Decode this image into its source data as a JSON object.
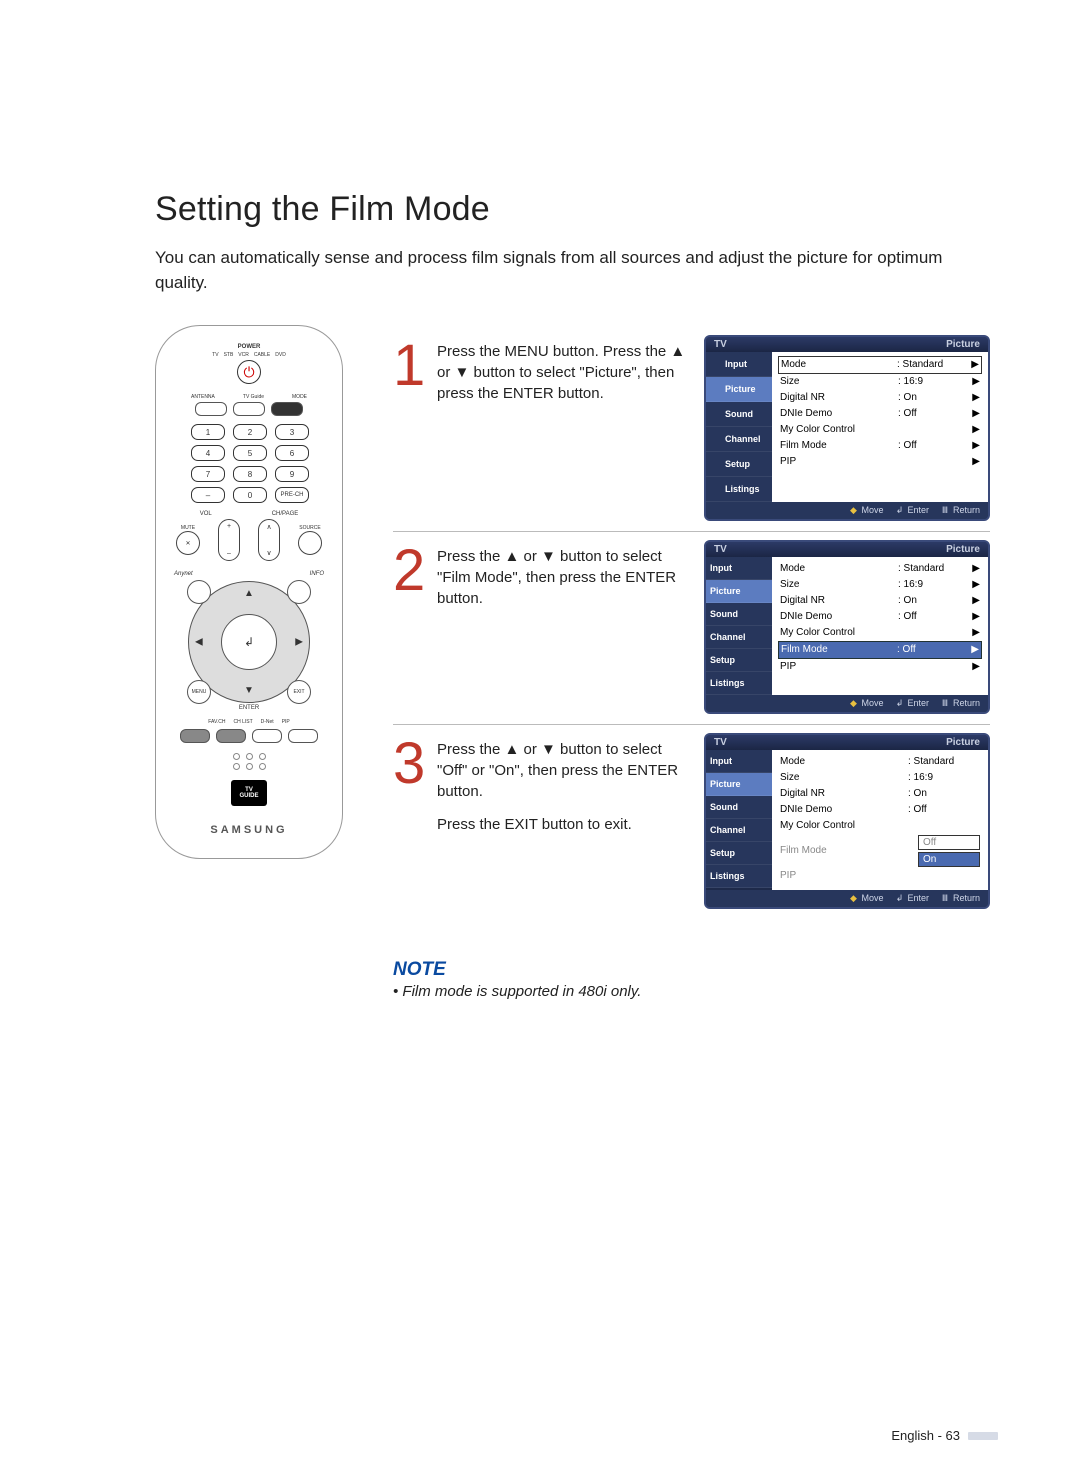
{
  "title": "Setting the Film Mode",
  "intro": "You can automatically sense and process film signals from all sources and adjust the picture for optimum quality.",
  "remote": {
    "power": "POWER",
    "devices": [
      "TV",
      "STB",
      "VCR",
      "CABLE",
      "DVD"
    ],
    "row_labels": [
      "ANTENNA",
      "TV Guide",
      "MODE"
    ],
    "prech": "PRE-CH",
    "vol": "VOL",
    "chpage": "CH/PAGE",
    "mute": "MUTE",
    "source": "SOURCE",
    "anynet": "Anynet",
    "info": "INFO",
    "menu": "MENU",
    "exit": "EXIT",
    "enter": "ENTER",
    "bottom_labels": [
      "FAV.CH",
      "CH LIST",
      "D-Net",
      "PIP"
    ],
    "tvguide_a": "TV",
    "tvguide_b": "GUIDE",
    "brand": "SAMSUNG"
  },
  "steps": [
    {
      "num": "1",
      "text": "Press the MENU button. Press the ▲ or ▼ button to select \"Picture\", then press the ENTER button."
    },
    {
      "num": "2",
      "text": "Press the ▲ or ▼ button to select \"Film Mode\", then press the ENTER button."
    },
    {
      "num": "3",
      "text_a": "Press the ▲ or ▼ button to select \"Off\" or \"On\", then press the ENTER button.",
      "text_b": "Press the EXIT button to exit."
    }
  ],
  "osd": {
    "tv": "TV",
    "section": "Picture",
    "tabs": [
      "Input",
      "Picture",
      "Sound",
      "Channel",
      "Setup",
      "Listings"
    ],
    "items": [
      {
        "k": "Mode",
        "v": ": Standard"
      },
      {
        "k": "Size",
        "v": ": 16:9"
      },
      {
        "k": "Digital NR",
        "v": ": On"
      },
      {
        "k": "DNIe Demo",
        "v": ": Off"
      },
      {
        "k": "My Color Control",
        "v": ""
      },
      {
        "k": "Film Mode",
        "v": ": Off"
      },
      {
        "k": "PIP",
        "v": ""
      }
    ],
    "options": [
      "Off",
      "On"
    ],
    "foot_move": "Move",
    "foot_enter": "Enter",
    "foot_return": "Return"
  },
  "note": {
    "label": "NOTE",
    "text": "• Film mode is supported in 480i only."
  },
  "footer": "English - 63"
}
